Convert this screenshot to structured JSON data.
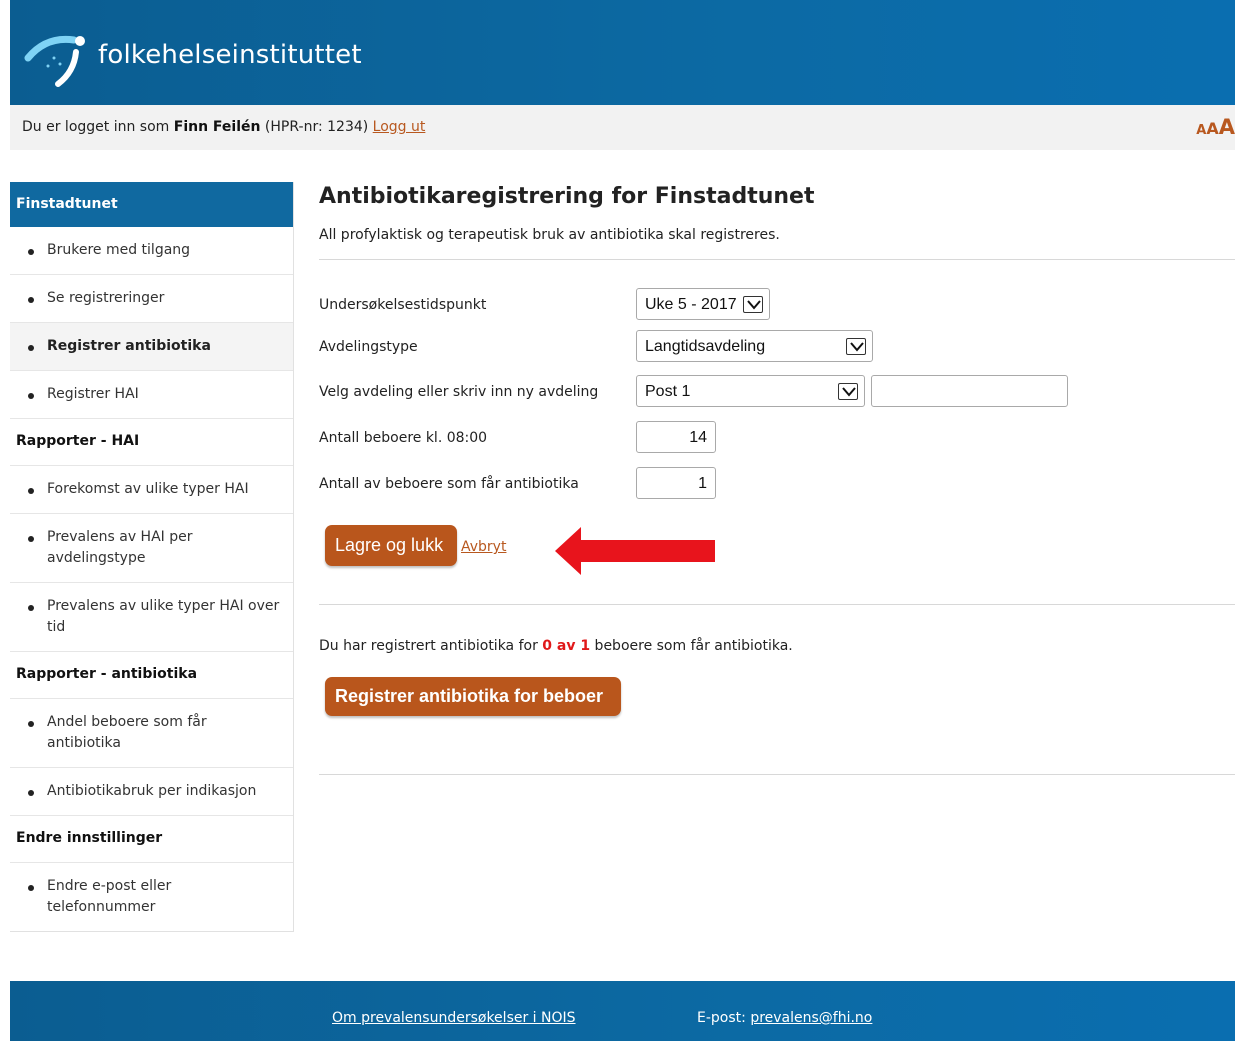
{
  "header": {
    "logo_text": "folkehelseinstituttet"
  },
  "login": {
    "prefix": "Du er logget inn som ",
    "user_name": "Finn Feilén",
    "hpr": " (HPR-nr: 1234) ",
    "logout": "Logg ut",
    "font_small": "A",
    "font_medium": "A",
    "font_large": "A"
  },
  "sidebar": {
    "active_section": "Finstadtunet",
    "section1_items": [
      "Brukere med tilgang",
      "Se registreringer",
      "Registrer antibiotika",
      "Registrer HAI"
    ],
    "section2_title": "Rapporter - HAI",
    "section2_items": [
      "Forekomst av ulike typer HAI",
      "Prevalens av HAI per avdelingstype",
      "Prevalens av ulike typer HAI over tid"
    ],
    "section3_title": "Rapporter - antibiotika",
    "section3_items": [
      "Andel beboere som får antibiotika",
      "Antibiotikabruk per indikasjon"
    ],
    "section4_title": "Endre innstillinger",
    "section4_items": [
      "Endre e-post eller telefonnummer"
    ]
  },
  "main": {
    "title": "Antibiotikaregistrering for Finstadtunet",
    "subtitle": "All profylaktisk og terapeutisk bruk av antibiotika skal registreres.",
    "form": {
      "time_label": "Undersøkelsestidspunkt",
      "time_value": "Uke 5 - 2017",
      "type_label": "Avdelingstype",
      "type_value": "Langtidsavdeling",
      "dept_label": "Velg avdeling eller skriv inn ny avdeling",
      "dept_value": "Post 1",
      "new_dept_value": "",
      "residents_label": "Antall beboere kl. 08:00",
      "residents_value": "14",
      "ab_label": "Antall av beboere som får antibiotika",
      "ab_value": "1"
    },
    "save_button": "Lagre og lukk",
    "cancel_link": "Avbryt",
    "status_prefix": "Du har registrert antibiotika for ",
    "status_count": "0 av 1",
    "status_suffix": " beboere som får antibiotika.",
    "register_button": "Registrer antibiotika for beboer"
  },
  "footer": {
    "about_link": "Om prevalensundersøkelser i NOIS",
    "email_label": "E-post: ",
    "email": "prevalens@fhi.no"
  },
  "colors": {
    "header_blue": "#0c6aa4",
    "button_orange": "#b9561c",
    "link": "#b8581f",
    "highlight_red": "#e0191a",
    "arrow_red": "#e8141c"
  }
}
